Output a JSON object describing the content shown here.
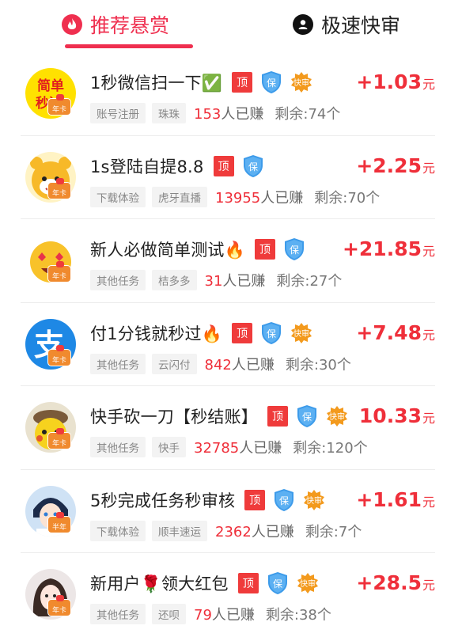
{
  "tabs": [
    {
      "label": "推荐悬赏",
      "icon": "fire-icon",
      "active": true
    },
    {
      "label": "极速快审",
      "icon": "user-icon",
      "active": false
    }
  ],
  "colors": {
    "accent": "#ef2f4f",
    "reward": "#ef2f3a",
    "top_badge": "#ef3b3b",
    "shield": "#3d9bea",
    "fast": "#f39a1d"
  },
  "badges": {
    "top": "顶",
    "shield": "保",
    "fast": "快审"
  },
  "earned_suffix": "人已赚",
  "remaining_prefix": "剩余:",
  "remaining_suffix": "个",
  "reward_unit": "元",
  "tasks": [
    {
      "title": "1秒微信扫一下✅",
      "reward": "+1.03",
      "tags": [
        "账号注册",
        "珠珠"
      ],
      "earned": "153",
      "remaining": "74",
      "badges": [
        "top",
        "shield",
        "fast"
      ],
      "avatar": {
        "kind": "text",
        "text": "简单秒过",
        "badge": "年卡"
      }
    },
    {
      "title": "1s登陆自提8.8",
      "reward": "+2.25",
      "tags": [
        "下载体验",
        "虎牙直播"
      ],
      "earned": "13955",
      "remaining": "70",
      "badges": [
        "top",
        "shield"
      ],
      "avatar": {
        "kind": "tiger",
        "badge": "年卡"
      }
    },
    {
      "title": "新人必做简单测试🔥",
      "reward": "+21.85",
      "tags": [
        "其他任务",
        "桔多多"
      ],
      "earned": "31",
      "remaining": "27",
      "badges": [
        "top",
        "shield"
      ],
      "avatar": {
        "kind": "emoji",
        "badge": "年卡"
      }
    },
    {
      "title": "付1分钱就秒过🔥",
      "reward": "+7.48",
      "tags": [
        "其他任务",
        "云闪付"
      ],
      "earned": "842",
      "remaining": "30",
      "badges": [
        "top",
        "shield",
        "fast"
      ],
      "avatar": {
        "kind": "alipay",
        "badge": "年卡"
      }
    },
    {
      "title": "快手砍一刀【秒结账】",
      "reward": "10.33",
      "tags": [
        "其他任务",
        "快手"
      ],
      "earned": "32785",
      "remaining": "120",
      "badges": [
        "top",
        "shield",
        "fast"
      ],
      "avatar": {
        "kind": "pikachu",
        "badge": "年卡"
      }
    },
    {
      "title": "5秒完成任务秒审核",
      "reward": "+1.61",
      "tags": [
        "下载体验",
        "顺丰速运"
      ],
      "earned": "2362",
      "remaining": "7",
      "badges": [
        "top",
        "shield",
        "fast"
      ],
      "avatar": {
        "kind": "anime",
        "badge": "半年"
      }
    },
    {
      "title": "新用户🌹领大红包",
      "reward": "+28.5",
      "tags": [
        "其他任务",
        "还呗"
      ],
      "earned": "79",
      "remaining": "38",
      "badges": [
        "top",
        "shield",
        "fast"
      ],
      "avatar": {
        "kind": "girl",
        "badge": "年卡"
      }
    }
  ]
}
